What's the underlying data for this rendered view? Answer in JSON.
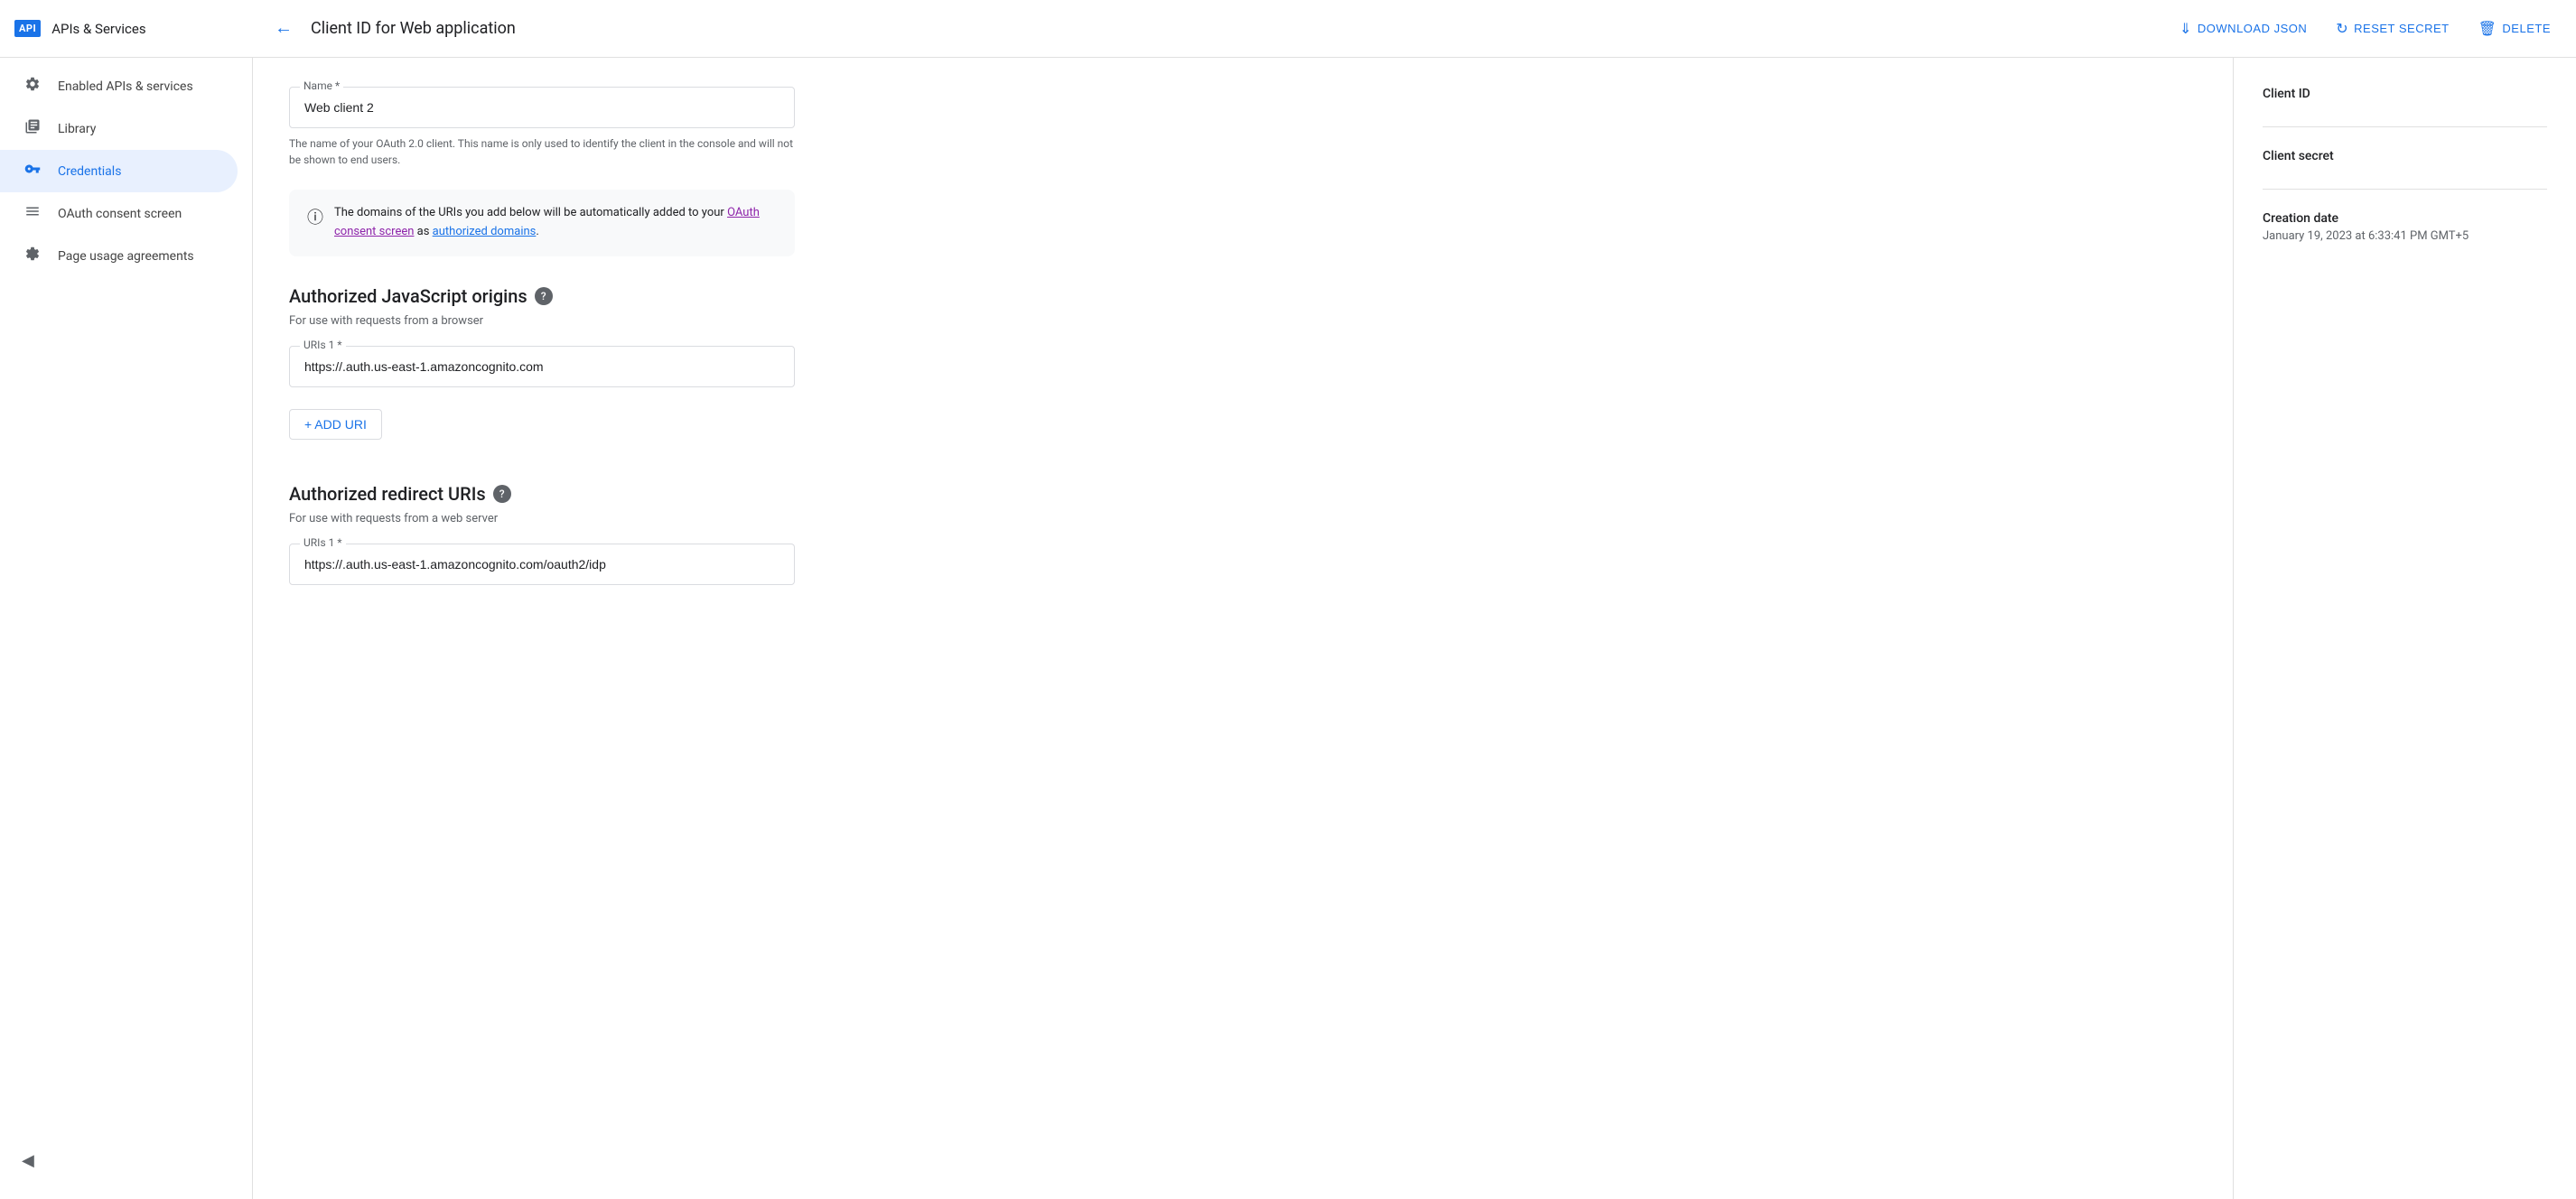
{
  "topbar": {
    "logo_text": "API",
    "brand": "APIs & Services",
    "page_title": "Client ID for Web application",
    "download_json_label": "DOWNLOAD JSON",
    "reset_secret_label": "RESET SECRET",
    "delete_label": "DELETE"
  },
  "sidebar": {
    "items": [
      {
        "id": "enabled-apis",
        "label": "Enabled APIs & services",
        "icon": "⚙"
      },
      {
        "id": "library",
        "label": "Library",
        "icon": "▦"
      },
      {
        "id": "credentials",
        "label": "Credentials",
        "icon": "🔑",
        "active": true
      },
      {
        "id": "oauth-consent",
        "label": "OAuth consent screen",
        "icon": "⋮⋮"
      },
      {
        "id": "page-usage",
        "label": "Page usage agreements",
        "icon": "⚙"
      }
    ],
    "collapse_icon": "◀"
  },
  "form": {
    "name_label": "Name *",
    "name_value": "Web client 2",
    "name_hint": "The name of your OAuth 2.0 client. This name is only used to identify the client in the console and will not be shown to end users.",
    "info_text_part1": "The domains of the URIs you add below will be automatically added to your ",
    "info_link1": "OAuth consent screen",
    "info_text_part2": " as ",
    "info_link2": "authorized domains",
    "info_text_part3": ".",
    "js_origins_title": "Authorized JavaScript origins",
    "js_origins_help": "?",
    "js_origins_desc": "For use with requests from a browser",
    "uri1_label": "URIs 1 *",
    "uri1_value": "https://.auth.us-east-1.amazoncognito.com",
    "add_uri_label": "+ ADD URI",
    "redirect_uris_title": "Authorized redirect URIs",
    "redirect_uris_help": "?",
    "redirect_uris_desc": "For use with requests from a web server",
    "redirect_uri1_label": "URIs 1 *",
    "redirect_uri1_value": "https://.auth.us-east-1.amazoncognito.com/oauth2/idp"
  },
  "right_panel": {
    "client_id_label": "Client ID",
    "client_id_value": "",
    "client_secret_label": "Client secret",
    "client_secret_value": "",
    "creation_date_label": "Creation date",
    "creation_date_value": "January 19, 2023 at 6:33:41 PM GMT+5"
  }
}
